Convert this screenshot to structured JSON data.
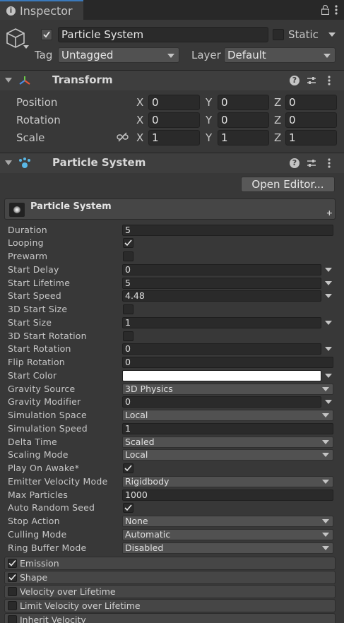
{
  "window": {
    "tab_title": "Inspector"
  },
  "object": {
    "name": "Particle System",
    "active": true,
    "static_label": "Static",
    "static": false,
    "tag_label": "Tag",
    "tag_value": "Untagged",
    "layer_label": "Layer",
    "layer_value": "Default"
  },
  "transform": {
    "title": "Transform",
    "rows": [
      {
        "label": "Position",
        "x": "0",
        "y": "0",
        "z": "0"
      },
      {
        "label": "Rotation",
        "x": "0",
        "y": "0",
        "z": "0"
      },
      {
        "label": "Scale",
        "x": "1",
        "y": "1",
        "z": "1"
      }
    ],
    "axis": {
      "x": "X",
      "y": "Y",
      "z": "Z"
    }
  },
  "particle_component": {
    "title": "Particle System",
    "open_editor_label": "Open Editor...",
    "module_title": "Particle System",
    "plus": "+"
  },
  "props": {
    "duration": {
      "label": "Duration",
      "value": "5"
    },
    "looping": {
      "label": "Looping",
      "checked": true
    },
    "prewarm": {
      "label": "Prewarm",
      "checked": false
    },
    "start_delay": {
      "label": "Start Delay",
      "value": "0"
    },
    "start_lifetime": {
      "label": "Start Lifetime",
      "value": "5"
    },
    "start_speed": {
      "label": "Start Speed",
      "value": "4.48"
    },
    "start_size_3d": {
      "label": "3D Start Size",
      "checked": false
    },
    "start_size": {
      "label": "Start Size",
      "value": "1"
    },
    "start_rotation_3d": {
      "label": "3D Start Rotation",
      "checked": false
    },
    "start_rotation": {
      "label": "Start Rotation",
      "value": "0"
    },
    "flip_rotation": {
      "label": "Flip Rotation",
      "value": "0"
    },
    "start_color": {
      "label": "Start Color",
      "color": "#ffffff"
    },
    "gravity_source": {
      "label": "Gravity Source",
      "value": "3D Physics"
    },
    "gravity_modifier": {
      "label": "Gravity Modifier",
      "value": "0"
    },
    "simulation_space": {
      "label": "Simulation Space",
      "value": "Local"
    },
    "simulation_speed": {
      "label": "Simulation Speed",
      "value": "1"
    },
    "delta_time": {
      "label": "Delta Time",
      "value": "Scaled"
    },
    "scaling_mode": {
      "label": "Scaling Mode",
      "value": "Local"
    },
    "play_on_awake": {
      "label": "Play On Awake*",
      "checked": true
    },
    "emitter_velocity_mode": {
      "label": "Emitter Velocity Mode",
      "value": "Rigidbody"
    },
    "max_particles": {
      "label": "Max Particles",
      "value": "1000"
    },
    "auto_random_seed": {
      "label": "Auto Random Seed",
      "checked": true
    },
    "stop_action": {
      "label": "Stop Action",
      "value": "None"
    },
    "culling_mode": {
      "label": "Culling Mode",
      "value": "Automatic"
    },
    "ring_buffer_mode": {
      "label": "Ring Buffer Mode",
      "value": "Disabled"
    }
  },
  "modules": [
    {
      "label": "Emission",
      "checked": true
    },
    {
      "label": "Shape",
      "checked": true
    },
    {
      "label": "Velocity over Lifetime",
      "checked": false
    },
    {
      "label": "Limit Velocity over Lifetime",
      "checked": false
    },
    {
      "label": "Inherit Velocity",
      "checked": false
    }
  ],
  "colors": {
    "tab_accent": "#3a79bb",
    "panel_bg": "#383838",
    "field_bg": "#2a2a2a"
  }
}
